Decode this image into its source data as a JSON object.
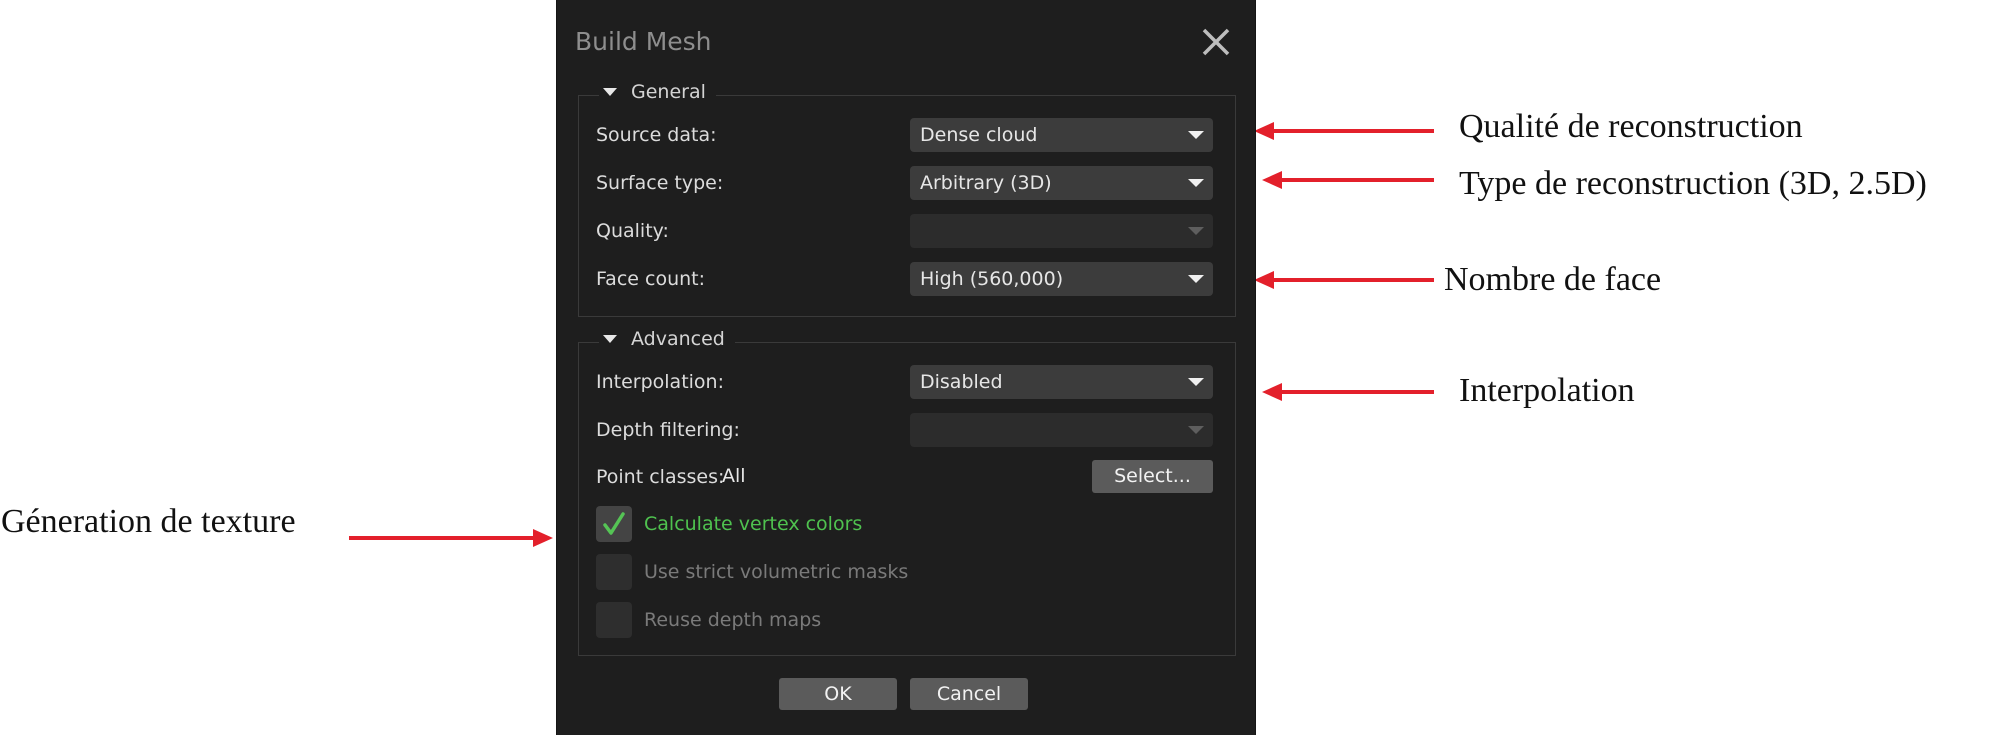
{
  "dialog": {
    "title": "Build Mesh",
    "close_icon": "close-icon",
    "general": {
      "label": "General",
      "source_data": {
        "label": "Source data:",
        "value": "Dense cloud"
      },
      "surface_type": {
        "label": "Surface type:",
        "value": "Arbitrary (3D)"
      },
      "quality": {
        "label": "Quality:",
        "value": ""
      },
      "face_count": {
        "label": "Face count:",
        "value": "High (560,000)"
      }
    },
    "advanced": {
      "label": "Advanced",
      "interpolation": {
        "label": "Interpolation:",
        "value": "Disabled"
      },
      "depth_filtering": {
        "label": "Depth filtering:",
        "value": ""
      },
      "point_classes": {
        "label": "Point classes:",
        "value": "All",
        "button": "Select..."
      },
      "calculate_vertex_colors": {
        "label": "Calculate vertex colors",
        "checked": true
      },
      "strict_volumetric_masks": {
        "label": "Use strict volumetric masks",
        "checked": false
      },
      "reuse_depth_maps": {
        "label": "Reuse depth maps",
        "checked": false
      }
    },
    "buttons": {
      "ok": "OK",
      "cancel": "Cancel"
    }
  },
  "annotations": {
    "quality": "Qualité de reconstruction",
    "type": "Type de reconstruction (3D, 2.5D)",
    "faces": "Nombre de face",
    "interpolation": "Interpolation",
    "texture": "Géneration de texture"
  },
  "colors": {
    "dialog_bg": "#1e1e1e",
    "checked_text": "#4fc24f",
    "annotation_arrow": "#e3202b"
  }
}
